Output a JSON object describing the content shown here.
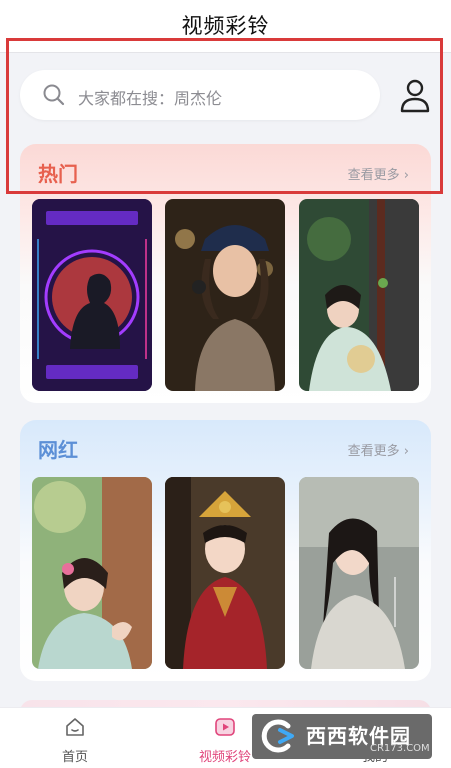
{
  "header": {
    "title": "视频彩铃"
  },
  "search": {
    "placeholder": "大家都在搜：周杰伦"
  },
  "sections": [
    {
      "title": "热门",
      "more_label": "查看更多"
    },
    {
      "title": "网红",
      "more_label": "查看更多"
    }
  ],
  "tabs": [
    {
      "label": "首页",
      "icon": "home-icon"
    },
    {
      "label": "视频彩铃",
      "icon": "video-ringtone-icon",
      "active": true
    },
    {
      "label": "我的",
      "icon": "profile-icon"
    }
  ],
  "watermark": {
    "brand": "西西软件园",
    "url": "CR173.COM"
  },
  "colors": {
    "accent": "#e0457b",
    "hot_title": "#e7614f",
    "wanghong_title": "#5c8fd6",
    "annotation": "#d93a3a"
  }
}
